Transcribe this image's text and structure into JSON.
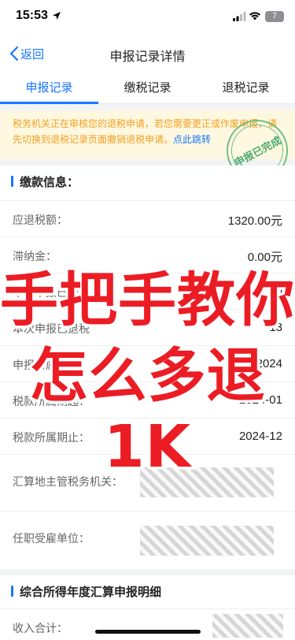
{
  "status_bar": {
    "time": "15:53",
    "battery": "7"
  },
  "nav": {
    "back_label": "返回",
    "title": "申报记录详情"
  },
  "tabs": [
    {
      "label": "申报记录",
      "active": true
    },
    {
      "label": "缴税记录",
      "active": false
    },
    {
      "label": "退税记录",
      "active": false
    }
  ],
  "notice": {
    "text": "税务机关正在审核您的退税申请，若您需要更正或作废申报，请先切换到退税记录页面撤销退税申请。",
    "link": "点此跳转"
  },
  "stamp": {
    "text": "申报已完成"
  },
  "payment_section": {
    "title": "缴款信息：",
    "rows": [
      {
        "label": "应退税额：",
        "value": "1320.00元"
      },
      {
        "label": "滞纳金：",
        "value": "0.00元"
      },
      {
        "label": "本次申报已缴",
        "value": "0"
      },
      {
        "label": "本次申报已退税",
        "value": "13"
      },
      {
        "label": "申报所属年度：",
        "value": "2024"
      },
      {
        "label": "税款所属期起：",
        "value": "2024-01"
      },
      {
        "label": "税款所属期止：",
        "value": "2024-12"
      },
      {
        "label": "汇算地主管税务机关：",
        "value": ""
      },
      {
        "label": "任职受雇单位：",
        "value": ""
      }
    ]
  },
  "summary_section": {
    "title": "综合所得年度汇算申报明细",
    "rows": [
      {
        "label": "收入合计：",
        "value": ""
      }
    ]
  },
  "overlay": {
    "line1": "手把手教你",
    "line2": "怎么多退1K",
    "color": "#ec1c24"
  },
  "colors": {
    "accent": "#1677ff",
    "notice_text": "#f0a020",
    "stamp": "#3aa35f"
  }
}
